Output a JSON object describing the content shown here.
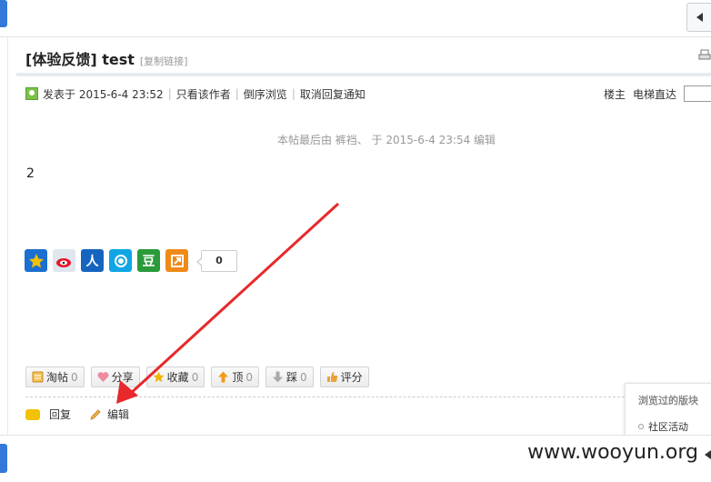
{
  "post": {
    "title": "[体验反馈] test",
    "copy_link": "[复制链接]",
    "posted": "发表于 2015-6-4 23:52",
    "only_author": "只看该作者",
    "reverse": "倒序浏览",
    "cancel_notify": "取消回复通知",
    "floor": "楼主",
    "elevator": "电梯直达",
    "edited_note": "本帖最后由 裤裆、 于 2015-6-4 23:54 编辑",
    "content": "2",
    "share_count": "0"
  },
  "actions": {
    "taotie": "淘帖",
    "taotie_count": "0",
    "share": "分享",
    "share_count": "",
    "favorite": "收藏",
    "favorite_count": "0",
    "up": "顶",
    "up_count": "0",
    "down": "踩",
    "down_count": "0",
    "rate": "评分"
  },
  "footer_actions": {
    "reply": "回复",
    "edit": "编辑"
  },
  "popup": {
    "title": "浏览过的版块",
    "item": "社区活动"
  },
  "watermark": "www.wooyun.org",
  "colors": {
    "accent_blue": "#3579d8",
    "arrow_red": "#e8282a"
  }
}
